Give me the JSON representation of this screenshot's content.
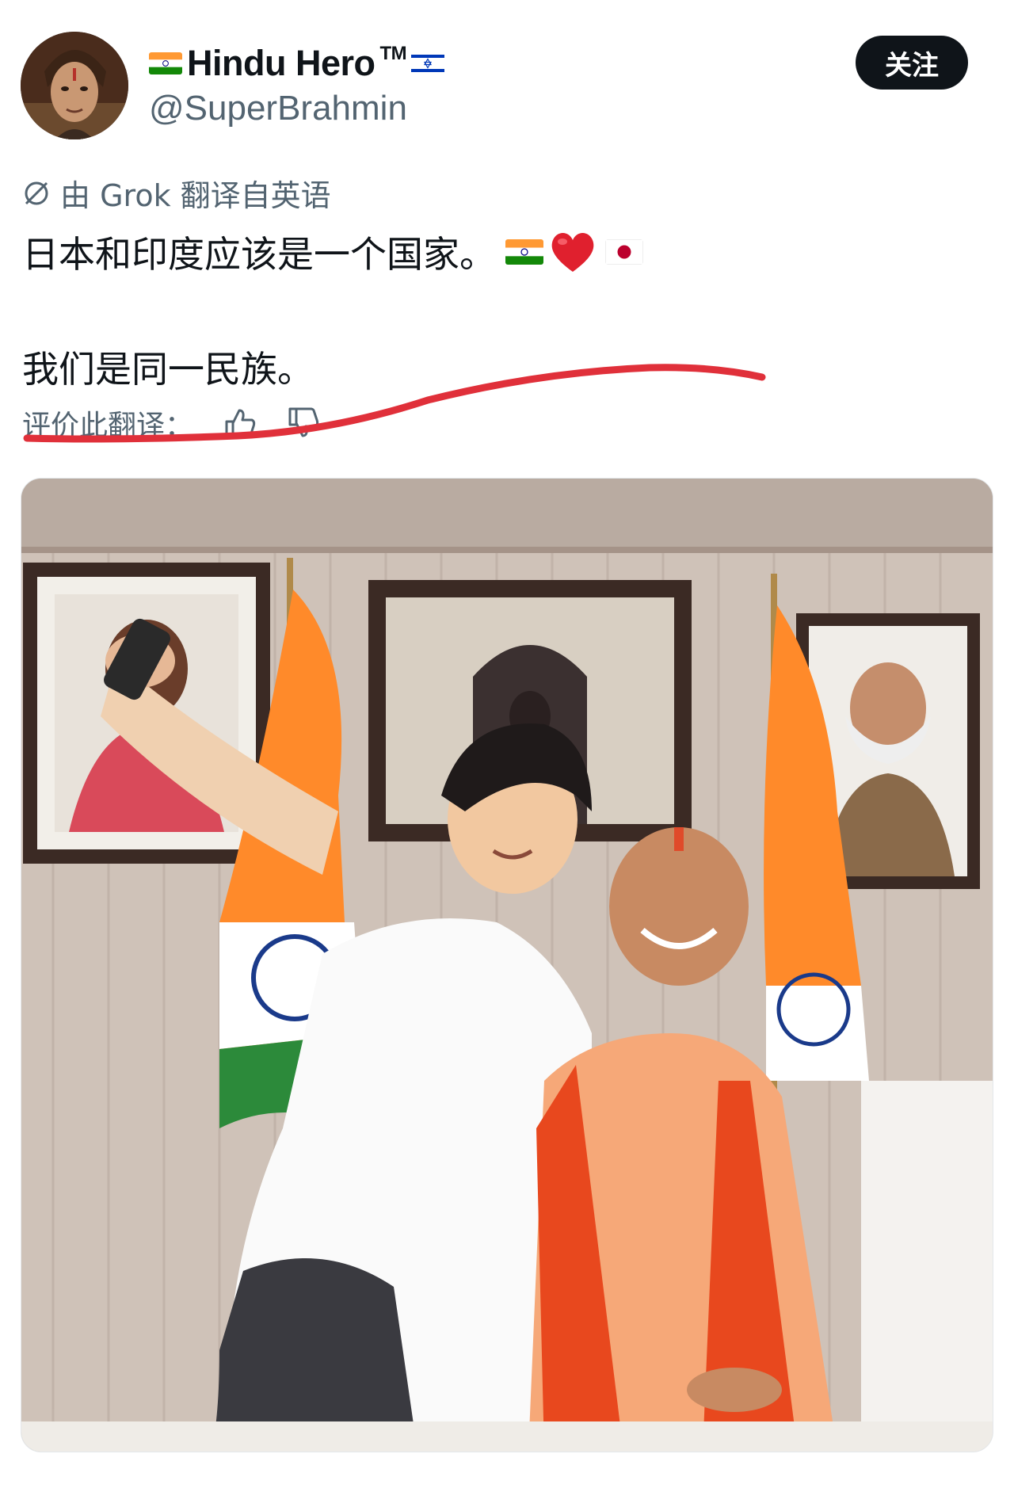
{
  "author": {
    "display_name": "Hindu Hero",
    "trademark": "TM",
    "handle": "@SuperBrahmin",
    "avatar_icon": "profile-avatar"
  },
  "follow_button": {
    "label": "关注"
  },
  "translation": {
    "note": "由 Grok 翻译自英语",
    "icon": "translate-icon"
  },
  "tweet": {
    "line1": "日本和印度应该是一个国家。",
    "line2": "我们是同一民族。",
    "emojis": [
      "india-flag",
      "red-heart",
      "japan-flag"
    ]
  },
  "rate": {
    "label": "评价此翻译：",
    "up_icon": "thumbs-up-icon",
    "down_icon": "thumbs-down-icon"
  },
  "colors": {
    "text": "#0f1419",
    "secondary": "#536471",
    "follow_bg": "#0f1419",
    "annotation_red": "#e0303a"
  },
  "media": {
    "alt_icon": "tweet-photo"
  }
}
